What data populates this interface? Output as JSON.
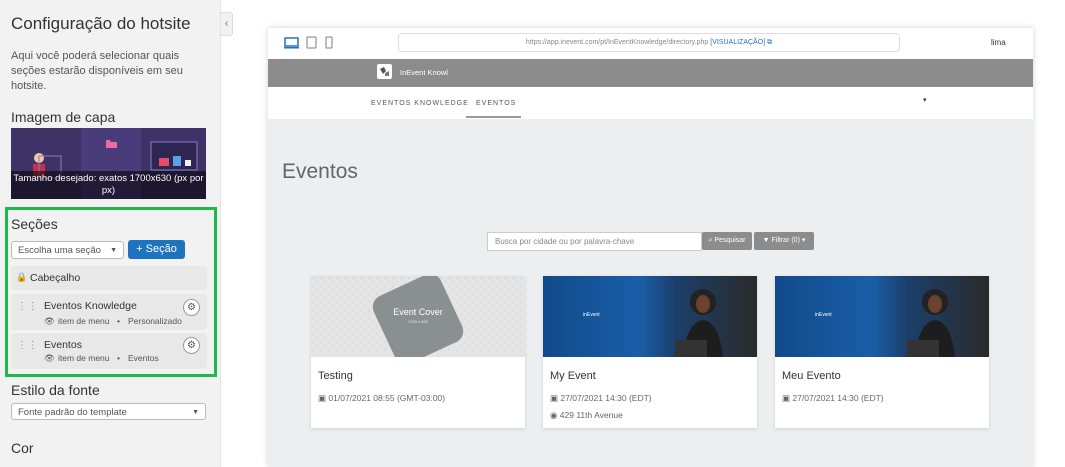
{
  "sidebar": {
    "title": "Configuração do hotsite",
    "description": "Aqui você poderá selecionar quais seções estarão disponíveis em seu hotsite.",
    "collapse_icon": "‹",
    "cover": {
      "heading": "Imagem de capa",
      "caption": "Tamanho desejado: exatos 1700x630 (px por px)"
    },
    "sections": {
      "heading": "Seções",
      "select_value": "Escolha uma seção",
      "add_label": "+ Seção",
      "items": [
        {
          "title": "Cabeçalho",
          "locked": true
        },
        {
          "title": "Eventos Knowledge",
          "visibility": "item de menu",
          "type": "Personalizado"
        },
        {
          "title": "Eventos",
          "visibility": "item de menu",
          "type": "Eventos"
        }
      ]
    },
    "font": {
      "heading": "Estilo da fonte",
      "value": "Fonte padrão do template"
    },
    "color": {
      "heading": "Cor"
    }
  },
  "preview": {
    "devices": [
      "desktop-icon",
      "tablet-icon",
      "phone-icon"
    ],
    "url": "https://app.inevent.com/pt/InEventKnowledge/directory.php",
    "url_tag": "[VISUALIZAÇÃO]",
    "user": "lima",
    "site_name": "InEvent Knowl",
    "nav": [
      "EVENTOS KNOWLEDGE",
      "EVENTOS"
    ],
    "nav_caret": "▾",
    "page_title": "Eventos",
    "search_placeholder": "Busca por cidade ou por palavra-chave",
    "search_button": "Pesquisar",
    "filter_button": "Filtrar (0)",
    "cover_placeholder": {
      "title": "Event Cover",
      "size": "1700 x 630"
    },
    "brand_logo_text": "inEvent",
    "events": [
      {
        "title": "Testing",
        "date": "01/07/2021 08:55 (GMT-03:00)",
        "location": ""
      },
      {
        "title": "My Event",
        "date": "27/07/2021 14:30 (EDT)",
        "location": "429 11th Avenue"
      },
      {
        "title": "Meu Evento",
        "date": "27/07/2021 14:30 (EDT)",
        "location": ""
      }
    ]
  },
  "colors": {
    "accent": "#1e73be",
    "highlight": "#1db84a",
    "header_gray": "#8c8c8c"
  }
}
